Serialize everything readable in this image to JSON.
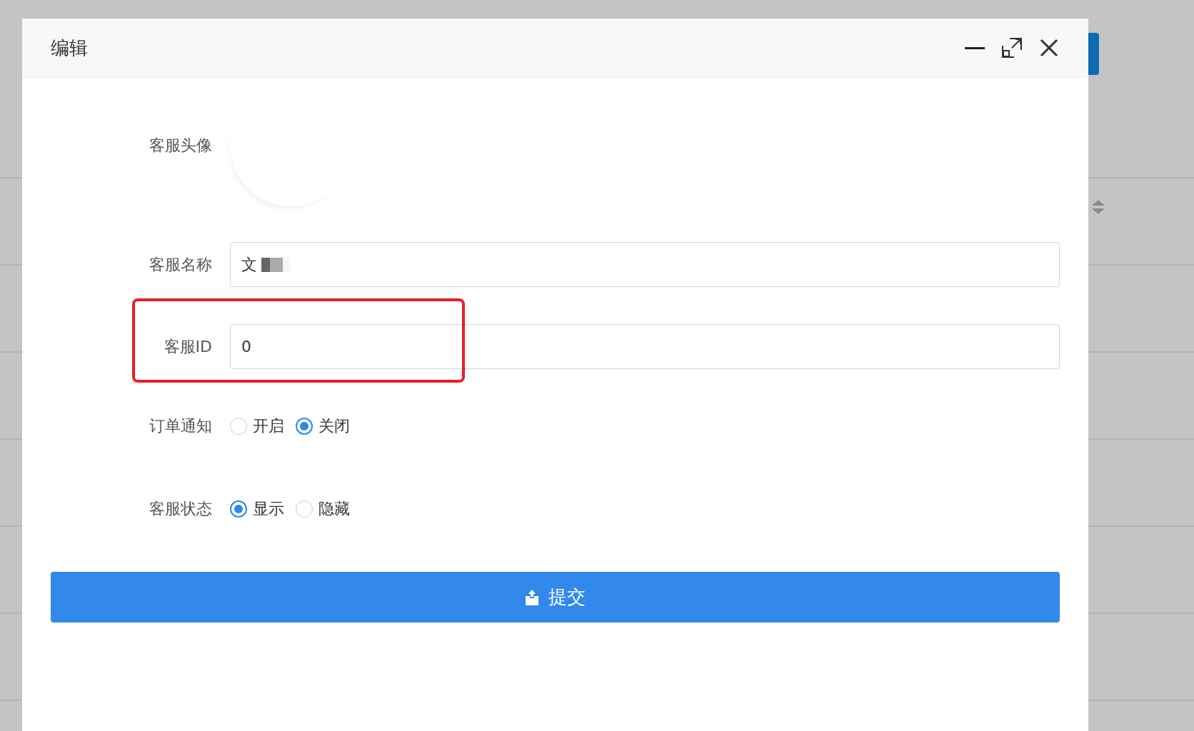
{
  "dialog": {
    "title": "编辑"
  },
  "form": {
    "avatar_label": "客服头像",
    "fields": [
      {
        "label": "客服名称",
        "value": "文",
        "highlighted": false
      },
      {
        "label": "客服ID",
        "value": "0",
        "highlighted": true
      }
    ],
    "radio_groups": [
      {
        "label": "订单通知",
        "options": [
          {
            "label": "开启",
            "selected": false
          },
          {
            "label": "关闭",
            "selected": true
          }
        ]
      },
      {
        "label": "客服状态",
        "options": [
          {
            "label": "显示",
            "selected": true
          },
          {
            "label": "隐藏",
            "selected": false
          }
        ]
      }
    ],
    "submit": "提交"
  }
}
